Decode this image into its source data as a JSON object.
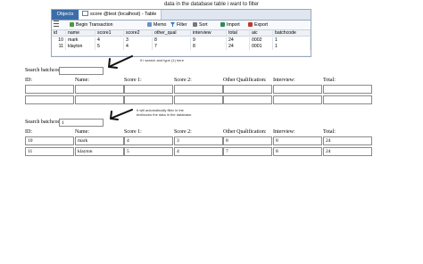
{
  "caption": "data in the database table i want to filter",
  "navicat": {
    "tabs": {
      "objects": "Objects",
      "table_tab": "score @test (localhost) - Table"
    },
    "toolbar": {
      "begin_transaction": "Begin Transaction",
      "memo": "Memo",
      "filter": "Filter",
      "sort": "Sort",
      "import": "Import",
      "export": "Export"
    },
    "columns": [
      "id",
      "name",
      "score1",
      "score2",
      "other_qual",
      "interview",
      "total",
      "aic",
      "batchcode"
    ],
    "rows": [
      [
        "10",
        "mark",
        "4",
        "3",
        "8",
        "9",
        "24",
        "0002",
        "1"
      ],
      [
        "11",
        "klayton",
        "5",
        "4",
        "7",
        "8",
        "24",
        "0001",
        "1"
      ]
    ],
    "icon_colors": {
      "begin": "#4a9a3a",
      "memo": "#6b8fc7",
      "filter": "#3a78c2",
      "sort": "#777777",
      "import": "#2e8b57",
      "export": "#c0392b",
      "tab_active_bg": "#3b6ea8"
    }
  },
  "note1": "If i search and type (1) here",
  "note2": {
    "line1": "It will automatically filter in the",
    "line2": "textboxes the data in the database."
  },
  "form1": {
    "search_label": "Search batchcode:",
    "search_value": "",
    "headers": [
      "ID:",
      "Name:",
      "Score 1:",
      "Score 2:",
      "Other Qualification:",
      "Interview:",
      "Total:"
    ],
    "rows": [
      [
        "",
        "",
        "",
        "",
        "",
        "",
        ""
      ],
      [
        "",
        "",
        "",
        "",
        "",
        "",
        ""
      ]
    ]
  },
  "form2": {
    "search_label": "Search batchcode:",
    "search_value": "1",
    "headers": [
      "ID:",
      "Name:",
      "Score 1:",
      "Score 2:",
      "Other Qualification:",
      "Interview:",
      "Total:"
    ],
    "rows": [
      [
        "10",
        "mark",
        "4",
        "3",
        "8",
        "8",
        "24"
      ],
      [
        "11",
        "klayton",
        "5",
        "4",
        "7",
        "8",
        "24"
      ]
    ]
  }
}
